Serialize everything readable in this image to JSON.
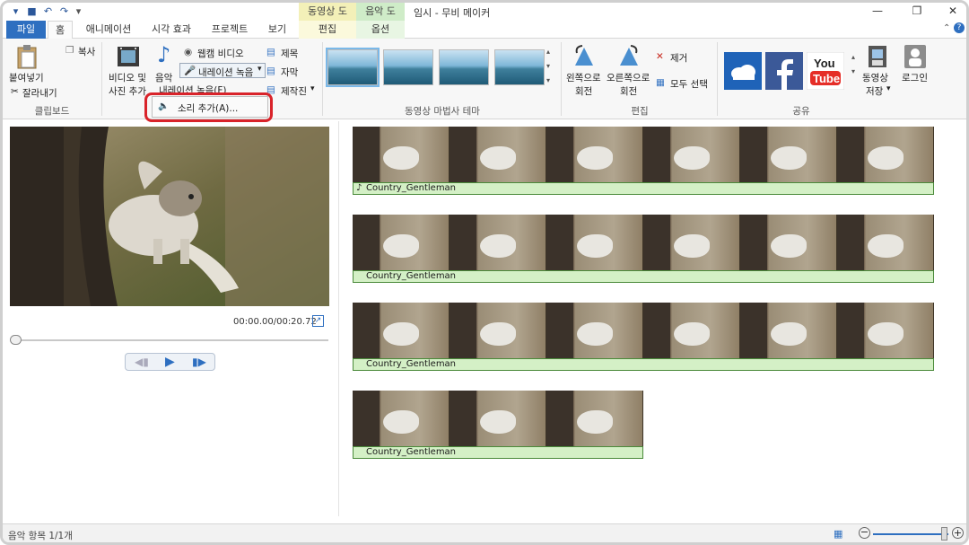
{
  "title_bar": {
    "window_title": "임시 - 무비 메이커",
    "context_video_tools": "동영상 도구",
    "context_audio_tools": "음악 도구"
  },
  "tabs": {
    "file": "파일",
    "home": "홈",
    "animation": "애니메이션",
    "visual_effects": "시각 효과",
    "project": "프로젝트",
    "view": "보기",
    "edit": "편집",
    "options": "옵션"
  },
  "ribbon": {
    "clipboard": {
      "paste": "붙여넣기",
      "copy": "복사",
      "cut": "잘라내기",
      "group_label": "클립보드"
    },
    "add": {
      "add_video_line1": "비디오 및",
      "add_video_line2": "사진 추가",
      "music": "음악",
      "webcam_video": "웹캠 비디오",
      "record_narration": "내레이션 녹음",
      "title": "제목",
      "caption": "자막",
      "credits": "제작진",
      "narration_menu_item": "내레이션 녹음(F)"
    },
    "themes": {
      "group_label": "동영상 마법사 테마"
    },
    "editing": {
      "rotate_left_line1": "왼쪽으로",
      "rotate_left_line2": "회전",
      "rotate_right_line1": "오른쪽으로",
      "rotate_right_line2": "회전",
      "remove": "제거",
      "select_all": "모두 선택",
      "group_label": "편집"
    },
    "share": {
      "save_movie_line1": "동영상",
      "save_movie_line2": "저장",
      "login": "로그인",
      "group_label": "공유"
    }
  },
  "dropdown": {
    "add_sound": "소리 추가(A)..."
  },
  "preview": {
    "time": "00:00.00/00:20.72"
  },
  "storyboard": {
    "rows": [
      {
        "audio": "Country_Gentleman",
        "frames": 6
      },
      {
        "audio": "Country_Gentleman",
        "frames": 6
      },
      {
        "audio": "Country_Gentleman",
        "frames": 6
      },
      {
        "audio": "Country_Gentleman",
        "frames": 3
      }
    ]
  },
  "status": {
    "text": "음악 항목 1/1개"
  }
}
